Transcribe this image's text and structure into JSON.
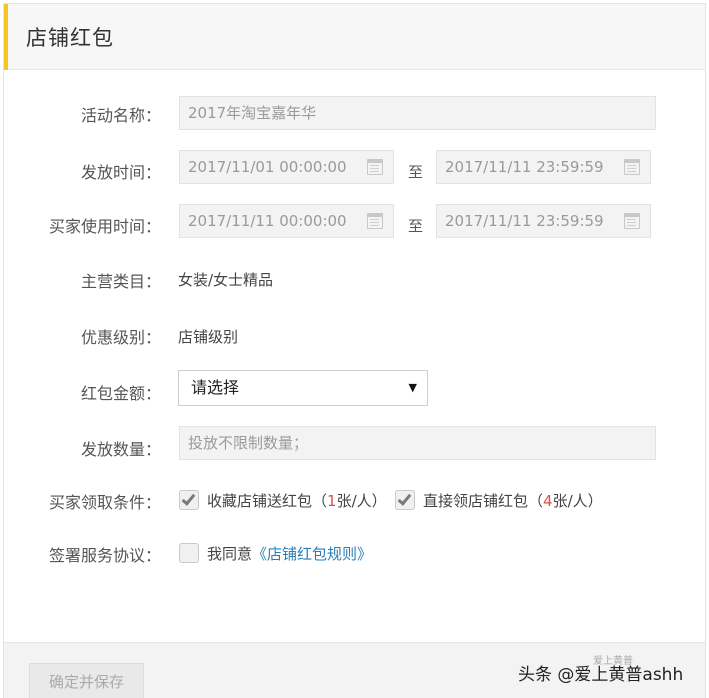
{
  "header": {
    "title": "店铺红包"
  },
  "form": {
    "activity_name": {
      "label": "活动名称：",
      "value": "2017年淘宝嘉年华"
    },
    "issue_time": {
      "label": "发放时间：",
      "start": "2017/11/01 00:00:00",
      "separator": "至",
      "end": "2017/11/11 23:59:59"
    },
    "use_time": {
      "label": "买家使用时间：",
      "start": "2017/11/11 00:00:00",
      "separator": "至",
      "end": "2017/11/11 23:59:59"
    },
    "main_category": {
      "label": "主营类目：",
      "value": "女装/女士精品"
    },
    "discount_level": {
      "label": "优惠级别：",
      "value": "店铺级别"
    },
    "amount": {
      "label": "红包金额：",
      "selected": "请选择"
    },
    "quantity": {
      "label": "发放数量：",
      "placeholder": "投放不限制数量；"
    },
    "conditions": {
      "label": "买家领取条件：",
      "options": [
        {
          "label_prefix": "收藏店铺送红包（",
          "count": "1",
          "label_suffix": "张/人）",
          "checked": true
        },
        {
          "label_prefix": "直接领店铺红包（",
          "count": "4",
          "label_suffix": "张/人）",
          "checked": true
        }
      ]
    },
    "agreement": {
      "label": "签署服务协议：",
      "text": "我同意",
      "link": "《店铺红包规则》",
      "checked": false
    }
  },
  "footer": {
    "save_label": "确定并保存"
  },
  "watermark": {
    "text": "头条 @爱上黄普ashh",
    "mark": "爱上黄普"
  },
  "colors": {
    "accent": "#f5c523",
    "link": "#2a7fb8",
    "count": "#d9534f"
  }
}
